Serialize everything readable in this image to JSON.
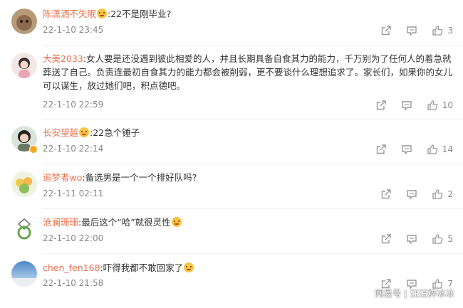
{
  "comments": [
    {
      "user": "陈潇洒不失眠",
      "text": ":22不是刚毕业?",
      "time": "22-1-10 23:45",
      "likes": "3"
    },
    {
      "user": "大美2033",
      "text": ":女人要是还没遇到彼此相爱的人，并且长期具备自食其力的能力，千万别为了任何人的着急就葬送了自己。负责连最初自食其力的能力都会被削弱，更不要谈什么理想追求了。家长们，如果你的女儿可以谋生，放过她们吧，积点德吧。",
      "time": "22-1-10 22:59",
      "likes": "10"
    },
    {
      "user": "长安望越",
      "text": ":22急个锤子",
      "time": "22-1-10 22:14",
      "likes": "14"
    },
    {
      "user": "追梦者wo",
      "text": ":备选男是一个一个排好队吗?",
      "time": "22-1-11 02:11",
      "likes": "2"
    },
    {
      "user": "沧澜珊珊",
      "text": ":最后这个“哈”就很灵性",
      "time": "22-1-10 22:00",
      "likes": "5"
    },
    {
      "user": "chen_fen168",
      "text": ":吓得我都不敢回家了",
      "time": "22-1-10 21:58",
      "likes": "7"
    }
  ],
  "icons": {
    "share": "share-icon",
    "comment": "comment-icon",
    "like": "thumbs-up-icon"
  },
  "colors": {
    "username": "#eb7350",
    "meta": "#888888",
    "text": "#333333"
  },
  "watermark": "网易号 | 汪汪粹冰冰"
}
